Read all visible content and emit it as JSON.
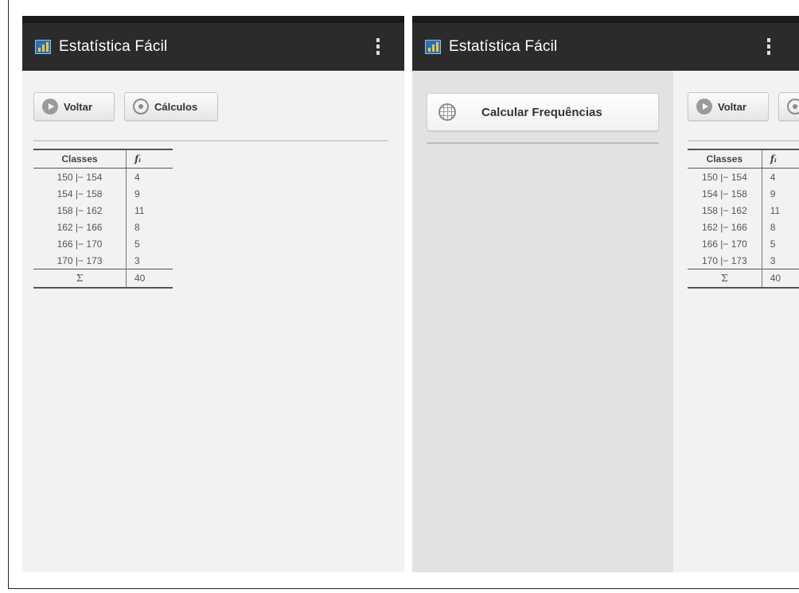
{
  "app": {
    "title": "Estatística Fácil"
  },
  "toolbar": {
    "back_label": "Voltar",
    "calc_label": "Cálculos"
  },
  "drawer": {
    "item_label": "Calcular Frequências"
  },
  "table": {
    "headers": {
      "classes": "Classes",
      "fi": "fᵢ"
    },
    "rows": [
      {
        "classes": "150 |− 154",
        "fi": "4"
      },
      {
        "classes": "154 |− 158",
        "fi": "9"
      },
      {
        "classes": "158 |− 162",
        "fi": "11"
      },
      {
        "classes": "162 |− 166",
        "fi": "8"
      },
      {
        "classes": "166 |− 170",
        "fi": "5"
      },
      {
        "classes": "170 |− 173",
        "fi": "3"
      }
    ],
    "total": {
      "symbol": "Σ",
      "value": "40"
    }
  },
  "icons": {
    "app": "bar-chart-icon",
    "back": "play-circle-icon",
    "calc": "radio-circle-icon",
    "drawer_item": "grid-globe-icon",
    "overflow": "overflow-menu-icon"
  },
  "colors": {
    "appbar": "#2b2b2b",
    "background": "#f2f2f2",
    "drawer": "#e2e2e2",
    "app_icon_blue": "#2c6fb5",
    "app_icon_bars": "#f0c534"
  }
}
